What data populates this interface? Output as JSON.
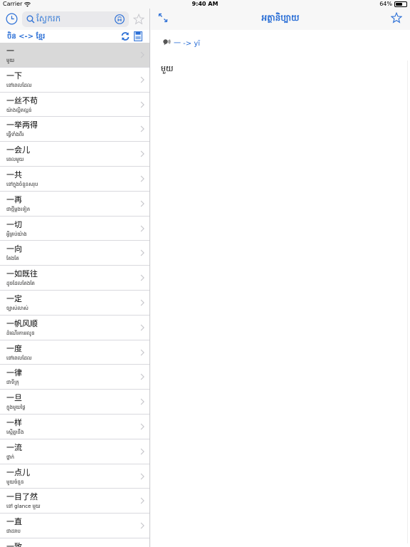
{
  "status_bar": {
    "carrier": "Carrier",
    "time": "9:40 AM",
    "battery": "64%",
    "battery_level": 0.64
  },
  "search": {
    "value": "ស្វែករក",
    "placeholder": ""
  },
  "direction": {
    "label": "ចិន <-> ខ្មែរ"
  },
  "detail": {
    "title": "អត្ថានិប្បាយ",
    "pronunciation": "一 -> yī",
    "definition": "មួយ"
  },
  "words": [
    {
      "zh": "一",
      "km": "មួយ"
    },
    {
      "zh": "一下",
      "km": "នៅពេលដែល"
    },
    {
      "zh": "一丝不苟",
      "km": "យ៉ាងល្អិតល្អន់"
    },
    {
      "zh": "一举两得",
      "km": "ធ្វើទាំងពីរ"
    },
    {
      "zh": "一会儿",
      "km": "ពេលមួយ"
    },
    {
      "zh": "一共",
      "km": "នៅក្នុងចំនួនសរុប"
    },
    {
      "zh": "一再",
      "km": "ជាថ្មីម្តងទៀត"
    },
    {
      "zh": "一切",
      "km": "អ្វីគ្រប់យ៉ាង"
    },
    {
      "zh": "一向",
      "km": "តែងតែ"
    },
    {
      "zh": "一如既往",
      "km": "ដូចដែលតែងតែ"
    },
    {
      "zh": "一定",
      "km": "ច្បាស់លាស់"
    },
    {
      "zh": "一帆风顺",
      "km": "ដំណើរការរលូន"
    },
    {
      "zh": "一度",
      "km": "នៅពេលដែល"
    },
    {
      "zh": "一律",
      "km": "ជាទីក្រុ"
    },
    {
      "zh": "一旦",
      "km": "ក្នុងមួយថ្ងៃ"
    },
    {
      "zh": "一样",
      "km": "ស្មើគ្នានឹង"
    },
    {
      "zh": "一流",
      "km": "ថ្នាក់"
    },
    {
      "zh": "一点儿",
      "km": "មួយចំនួន"
    },
    {
      "zh": "一目了然",
      "km": "នៅ glance មួយ"
    },
    {
      "zh": "一直",
      "km": "ជាដរាប"
    },
    {
      "zh": "一致",
      "km": ""
    }
  ],
  "colors": {
    "accent": "#2b6fd6",
    "selected_row": "#d9d9d9"
  }
}
